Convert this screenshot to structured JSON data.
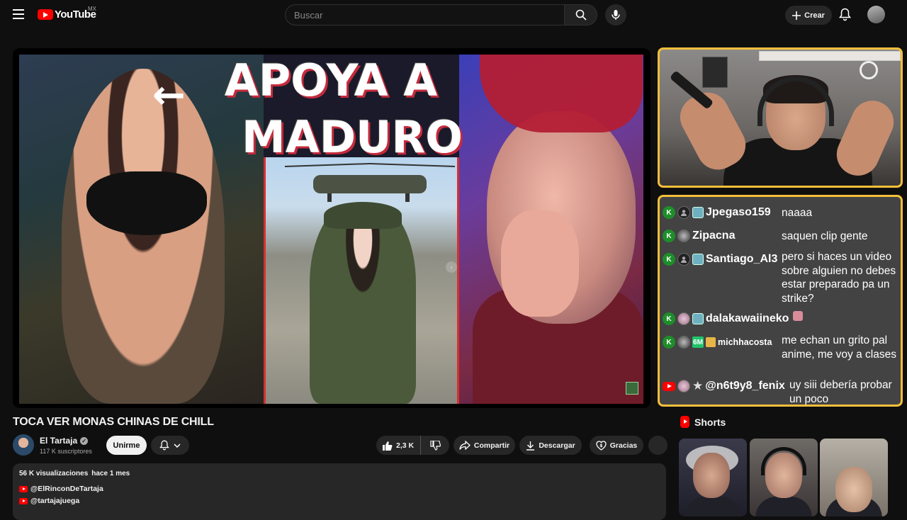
{
  "header": {
    "logo_text": "YouTube",
    "country": "MX",
    "search_placeholder": "Buscar",
    "create_label": "Crear"
  },
  "thumbnail": {
    "headline_line1": "APOYA A",
    "headline_line2": "MADURO"
  },
  "chat": {
    "messages": [
      {
        "badges": [
          "k-badge",
          "avatar-default",
          "emote-badge"
        ],
        "user": "Jpegaso159",
        "text": "naaaa"
      },
      {
        "badges": [
          "k-badge",
          "avatar-photo"
        ],
        "user": "Zipacna",
        "text": "saquen clip gente"
      },
      {
        "badges": [
          "k-badge",
          "avatar-default",
          "emote-badge"
        ],
        "user": "Santiago_Al3",
        "text": "pero si haces un video sobre alguien no debes estar preparado pa un strike?"
      },
      {
        "badges": [
          "k-badge",
          "avatar-pink",
          "emote-badge"
        ],
        "user": "dalakawaiineko",
        "text": ""
      },
      {
        "badges": [
          "k-badge",
          "avatar-photo",
          "6m-badge",
          "gift-badge"
        ],
        "user": "michhacosta",
        "text": "me echan un grito pal anime, me voy a clases"
      },
      {
        "badges": [
          "youtube-badge",
          "avatar-pink",
          "star-badge"
        ],
        "user": "@n6t9y8_fenix",
        "text": "uy siii debería probar un poco"
      }
    ]
  },
  "video": {
    "title": "TOCA VER MONAS CHINAS DE CHILL",
    "channel_name": "El Tartaja",
    "subscribers": "117 K suscriptores",
    "join_label": "Unirme",
    "likes": "2,3 K",
    "share_label": "Compartir",
    "download_label": "Descargar",
    "thanks_label": "Gracias"
  },
  "description": {
    "views": "56 K visualizaciones",
    "date": "hace 1 mes",
    "links": [
      "@ElRinconDeTartaja",
      "@tartajajuega"
    ]
  },
  "shorts": {
    "title": "Shorts"
  },
  "colors": {
    "background": "#0f0f0f",
    "accent_border": "#f4bf3a",
    "youtube_red": "#ff0000",
    "kick_green": "#1e8e2a"
  }
}
